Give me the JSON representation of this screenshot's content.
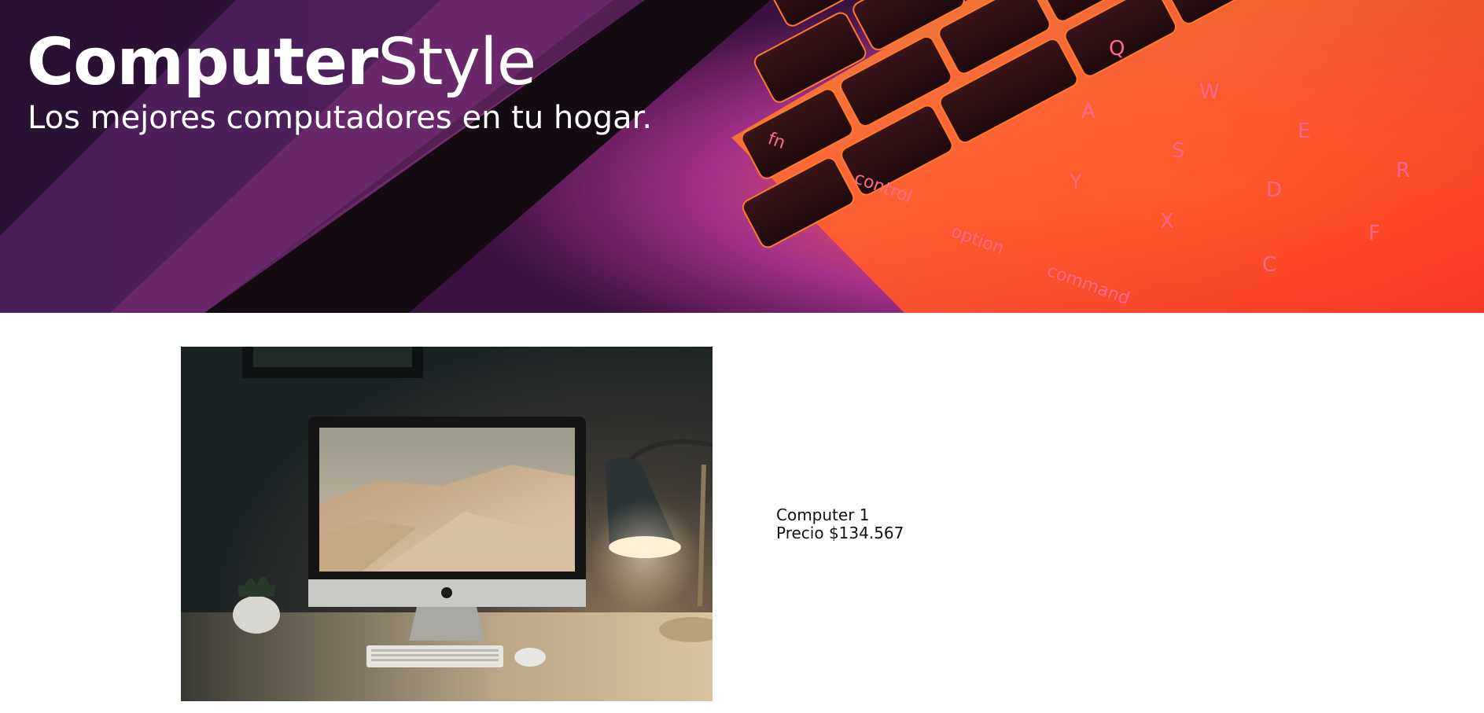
{
  "header": {
    "brand_bold": "Computer",
    "brand_light": "Style",
    "tagline": "Los mejores computadores en tu hogar.",
    "background_image": "laptop-keyboard-photo",
    "keyboard_keys": [
      "fn",
      "control",
      "option",
      "command",
      "A",
      "S",
      "D",
      "F",
      "Q",
      "W",
      "E",
      "R",
      "Y",
      "X",
      "C"
    ]
  },
  "products": [
    {
      "name": "Computer 1",
      "price_label": "Precio $134.567",
      "image": "desktop-computer-photo"
    }
  ],
  "colors": {
    "background": "#ffffff",
    "hero_text": "#ffffff",
    "key_glow": "#ff6a1a",
    "magenta": "#b0307a",
    "purple": "#4a1a6e"
  }
}
